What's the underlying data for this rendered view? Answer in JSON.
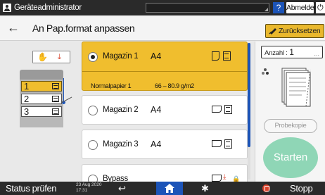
{
  "topbar": {
    "user": "Geräteadministrator",
    "help": "?",
    "logout": "Abmelden",
    "power_icon": "power-icon"
  },
  "header": {
    "back_icon": "arrow-left-icon",
    "title": "An Pap.format anpassen",
    "reset": "Zurücksetzen"
  },
  "trays_panel": {
    "drawers": [
      "1",
      "2",
      "3"
    ],
    "selected_drawer": "1"
  },
  "trays": [
    {
      "name": "Magazin 1",
      "size": "A4",
      "selected": true,
      "paper_type": "Normalpapier 1",
      "weight": "66 – 80.9 g/m2"
    },
    {
      "name": "Magazin 2",
      "size": "A4",
      "selected": false
    },
    {
      "name": "Magazin 3",
      "size": "A4",
      "selected": false
    },
    {
      "name": "Bypass",
      "size": "",
      "selected": false
    }
  ],
  "right_panel": {
    "count_label": "Anzahl :",
    "count_value": "1",
    "sample_copy": "Probekopie",
    "start": "Starten"
  },
  "bottombar": {
    "status": "Status prüfen",
    "date": "23 Aug 2020",
    "time": "17:31",
    "stop": "Stopp"
  },
  "colors": {
    "accent_yellow": "#f0be2e",
    "brand_blue": "#1c54b8",
    "start_green": "#8fd6b6",
    "stop_red": "#d8412a"
  }
}
